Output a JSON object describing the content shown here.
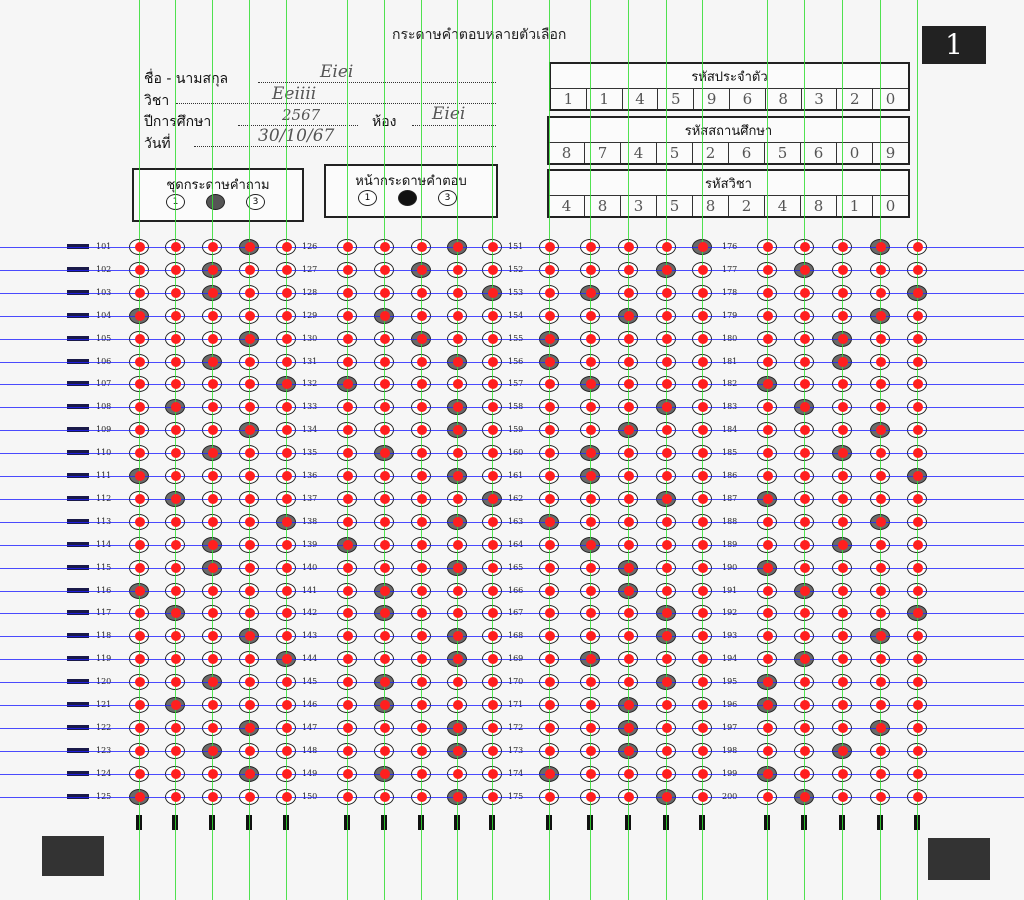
{
  "sheet": {
    "title": "กระดาษคำตอบหลายตัวเลือก",
    "page_number": "1",
    "fields": [
      {
        "label": "ชื่อ - นามสกุล",
        "value": "Eiei"
      },
      {
        "label": "วิชา",
        "value": "Eeiiii"
      },
      {
        "label": "ปีการศึกษา",
        "value": "2567"
      },
      {
        "label": "ห้อง",
        "value": "Eiei"
      },
      {
        "label": "วันที่",
        "value": "30/10/67"
      }
    ],
    "id_boxes": [
      {
        "title": "รหัสประจำตัว",
        "digits": [
          "1",
          "1",
          "4",
          "5",
          "9",
          "6",
          "8",
          "3",
          "2",
          "0"
        ]
      },
      {
        "title": "รหัสสถานศึกษา",
        "digits": [
          "8",
          "7",
          "4",
          "5",
          "2",
          "6",
          "5",
          "6",
          "0",
          "9"
        ]
      },
      {
        "title": "รหัสวิชา",
        "digits": [
          "4",
          "8",
          "3",
          "5",
          "8",
          "2",
          "4",
          "8",
          "1",
          "0"
        ]
      }
    ],
    "question_set": {
      "title": "ชุดกระดาษคำถาม",
      "options": [
        "1",
        "2",
        "3"
      ],
      "selected": 2
    },
    "page_select": {
      "title": "หน้ากระดาษคำตอบ",
      "options": [
        "1",
        "2",
        "3"
      ],
      "selected": 2
    },
    "option_labels": [
      "1",
      "2",
      "3",
      "4",
      "5"
    ],
    "block_starts": [
      101,
      126,
      151,
      176
    ],
    "answers": [
      [
        4,
        3,
        3,
        1,
        4,
        3,
        5,
        2,
        4,
        3,
        1,
        2,
        5,
        3,
        3,
        1,
        2,
        4,
        5,
        3,
        2,
        4,
        3,
        4,
        1
      ],
      [
        4,
        3,
        5,
        2,
        3,
        4,
        1,
        4,
        4,
        2,
        4,
        5,
        4,
        1,
        4,
        2,
        2,
        4,
        4,
        2,
        2,
        4,
        4,
        2,
        4
      ],
      [
        5,
        4,
        2,
        3,
        1,
        1,
        2,
        4,
        3,
        2,
        2,
        4,
        1,
        2,
        3,
        3,
        4,
        4,
        2,
        4,
        3,
        3,
        3,
        1,
        4
      ],
      [
        4,
        2,
        5,
        4,
        3,
        3,
        1,
        2,
        4,
        3,
        5,
        1,
        4,
        3,
        1,
        2,
        5,
        4,
        2,
        1,
        1,
        4,
        3,
        1,
        2
      ]
    ]
  },
  "overlay": {
    "horizontal_color": "#1f1fff",
    "vertical_color": "#33dd33",
    "point_color": "#ff1f1f"
  }
}
